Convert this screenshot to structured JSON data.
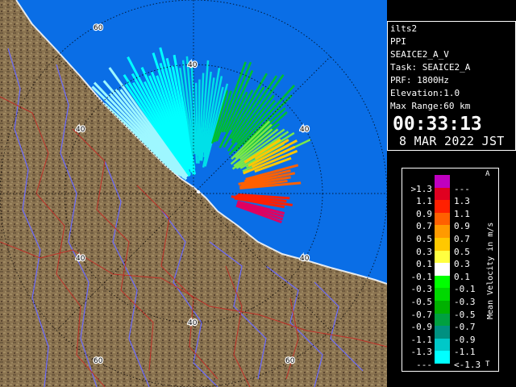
{
  "info": {
    "station": "ilts2",
    "scan_mode": "PPI",
    "product": "SEAICE2_A_V",
    "task_label": "Task: SEAICE2_A",
    "prf_label": "PRF: 1800Hz",
    "elevation_label": "Elevation:1.0",
    "max_range_label": "Max Range:60 km",
    "time": "00:33:13",
    "date": "8 MAR 2022 JST"
  },
  "legend": {
    "title": "Mean Velocity in m/s",
    "top_marker": "A",
    "bottom_marker": "T",
    "rows": [
      {
        "lo": ">1.3",
        "hi": "---",
        "color": "#c000c0"
      },
      {
        "lo": "1.1",
        "hi": "1.3",
        "color": "#e00020"
      },
      {
        "lo": "0.9",
        "hi": "1.1",
        "color": "#ff2000"
      },
      {
        "lo": "0.7",
        "hi": "0.9",
        "color": "#ff6000"
      },
      {
        "lo": "0.5",
        "hi": "0.7",
        "color": "#ff9a00"
      },
      {
        "lo": "0.3",
        "hi": "0.5",
        "color": "#ffc800"
      },
      {
        "lo": "0.1",
        "hi": "0.3",
        "color": "#ffff40"
      },
      {
        "lo": "-0.1",
        "hi": "0.1",
        "color": "#ffffff"
      },
      {
        "lo": "-0.3",
        "hi": "-0.1",
        "color": "#00ff00"
      },
      {
        "lo": "-0.5",
        "hi": "-0.3",
        "color": "#00d800"
      },
      {
        "lo": "-0.7",
        "hi": "-0.5",
        "color": "#00b000"
      },
      {
        "lo": "-0.9",
        "hi": "-0.7",
        "color": "#00a040"
      },
      {
        "lo": "-1.1",
        "hi": "-0.9",
        "color": "#009080"
      },
      {
        "lo": "-1.3",
        "hi": "-1.1",
        "color": "#00c8c8"
      },
      {
        "lo": "---",
        "hi": "<-1.3",
        "color": "#00ffff"
      }
    ]
  },
  "map": {
    "range_ring_labels": {
      "ring_40": "40",
      "ring_60": "60"
    },
    "colors": {
      "sea": "#0a6ee6",
      "land": "#8a7350",
      "land_dark": "#5a4530",
      "rivers": "#6a6aff",
      "boundaries": "#c03028",
      "rings": "#000000"
    }
  }
}
